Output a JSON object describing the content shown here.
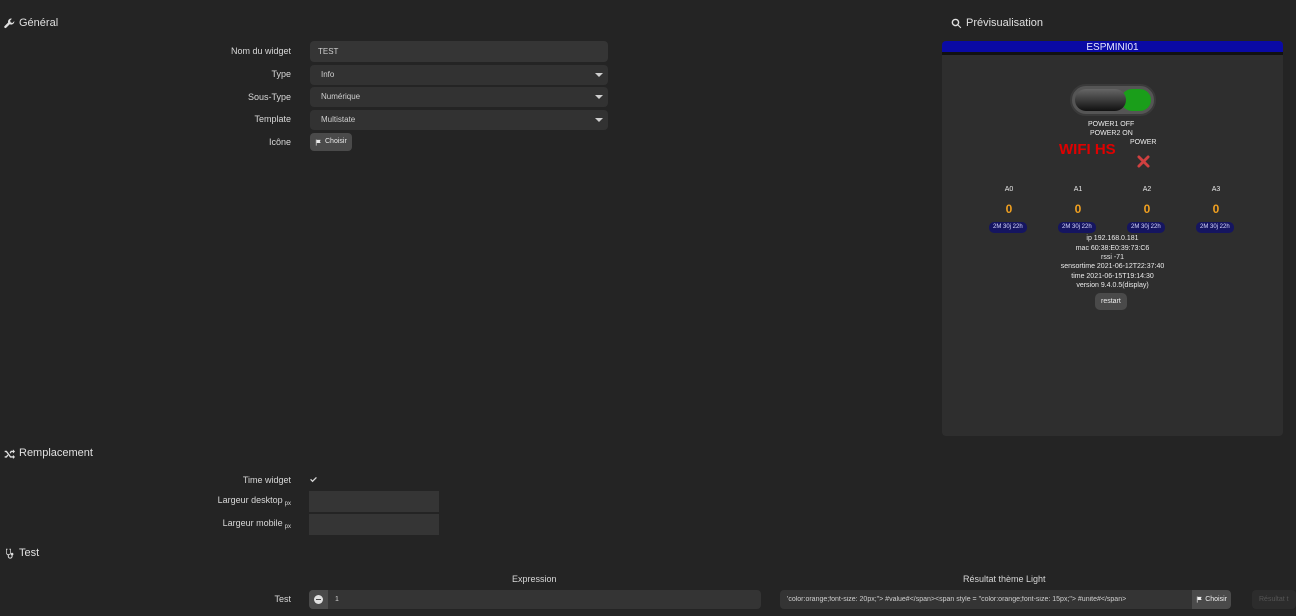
{
  "sections": {
    "general": "Général",
    "preview": "Prévisualisation",
    "replacement": "Remplacement",
    "test": "Test"
  },
  "general": {
    "name_label": "Nom du widget",
    "name_value": "TEST",
    "type_label": "Type",
    "type_value": "Info",
    "subtype_label": "Sous-Type",
    "subtype_value": "Numérique",
    "template_label": "Template",
    "template_value": "Multistate",
    "icon_label": "Icône",
    "icon_button": "Choisir"
  },
  "preview": {
    "device_title": "ESPMINI01",
    "power1": "POWER1 OFF",
    "power2": "POWER2 ON",
    "wifi": "WIFI HS",
    "power_label": "POWER",
    "analog": [
      {
        "label": "A0",
        "value": "0",
        "badge": "2M 30j 22h"
      },
      {
        "label": "A1",
        "value": "0",
        "badge": "2M 30j 22h"
      },
      {
        "label": "A2",
        "value": "0",
        "badge": "2M 30j 22h"
      },
      {
        "label": "A3",
        "value": "0",
        "badge": "2M 30j 22h"
      }
    ],
    "info": {
      "ip": "ip 192.168.0.181",
      "mac": "mac 60:38:E0:39:73:C6",
      "rssi": "rssi -71",
      "sensortime": "sensortime 2021-06-12T22:37:40",
      "time": "time 2021-06-15T19:14:30",
      "version": "version 9.4.0.5(display)"
    },
    "restart_label": "restart"
  },
  "replacement": {
    "time_widget_label": "Time widget",
    "desktop_label": "Largeur desktop",
    "mobile_label": "Largeur mobile",
    "unit": "px"
  },
  "test": {
    "col_expression": "Expression",
    "col_result": "Résultat thème Light",
    "row_label": "Test",
    "expression_value": "1",
    "result_value": "'color:orange;font-size: 20px;\"> #value#</span><span  style = \"color:orange;font-size: 15px;\"> #unite#</span>",
    "result_button": "Choisir",
    "result_clip": "Résultat t"
  },
  "colors": {
    "background": "#242424",
    "preview_header": "#0a0aa5",
    "wifi_red": "#e00000",
    "value_orange": "#f0a020",
    "toggle_green": "#1a9e1a"
  }
}
